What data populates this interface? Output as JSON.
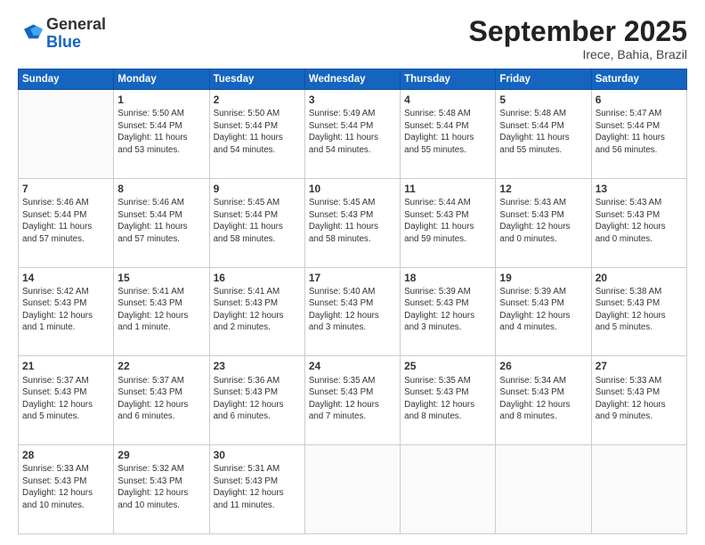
{
  "logo": {
    "general": "General",
    "blue": "Blue"
  },
  "header": {
    "month": "September 2025",
    "location": "Irece, Bahia, Brazil"
  },
  "weekdays": [
    "Sunday",
    "Monday",
    "Tuesday",
    "Wednesday",
    "Thursday",
    "Friday",
    "Saturday"
  ],
  "weeks": [
    [
      {
        "day": "",
        "text": ""
      },
      {
        "day": "1",
        "text": "Sunrise: 5:50 AM\nSunset: 5:44 PM\nDaylight: 11 hours\nand 53 minutes."
      },
      {
        "day": "2",
        "text": "Sunrise: 5:50 AM\nSunset: 5:44 PM\nDaylight: 11 hours\nand 54 minutes."
      },
      {
        "day": "3",
        "text": "Sunrise: 5:49 AM\nSunset: 5:44 PM\nDaylight: 11 hours\nand 54 minutes."
      },
      {
        "day": "4",
        "text": "Sunrise: 5:48 AM\nSunset: 5:44 PM\nDaylight: 11 hours\nand 55 minutes."
      },
      {
        "day": "5",
        "text": "Sunrise: 5:48 AM\nSunset: 5:44 PM\nDaylight: 11 hours\nand 55 minutes."
      },
      {
        "day": "6",
        "text": "Sunrise: 5:47 AM\nSunset: 5:44 PM\nDaylight: 11 hours\nand 56 minutes."
      }
    ],
    [
      {
        "day": "7",
        "text": "Sunrise: 5:46 AM\nSunset: 5:44 PM\nDaylight: 11 hours\nand 57 minutes."
      },
      {
        "day": "8",
        "text": "Sunrise: 5:46 AM\nSunset: 5:44 PM\nDaylight: 11 hours\nand 57 minutes."
      },
      {
        "day": "9",
        "text": "Sunrise: 5:45 AM\nSunset: 5:44 PM\nDaylight: 11 hours\nand 58 minutes."
      },
      {
        "day": "10",
        "text": "Sunrise: 5:45 AM\nSunset: 5:43 PM\nDaylight: 11 hours\nand 58 minutes."
      },
      {
        "day": "11",
        "text": "Sunrise: 5:44 AM\nSunset: 5:43 PM\nDaylight: 11 hours\nand 59 minutes."
      },
      {
        "day": "12",
        "text": "Sunrise: 5:43 AM\nSunset: 5:43 PM\nDaylight: 12 hours\nand 0 minutes."
      },
      {
        "day": "13",
        "text": "Sunrise: 5:43 AM\nSunset: 5:43 PM\nDaylight: 12 hours\nand 0 minutes."
      }
    ],
    [
      {
        "day": "14",
        "text": "Sunrise: 5:42 AM\nSunset: 5:43 PM\nDaylight: 12 hours\nand 1 minute."
      },
      {
        "day": "15",
        "text": "Sunrise: 5:41 AM\nSunset: 5:43 PM\nDaylight: 12 hours\nand 1 minute."
      },
      {
        "day": "16",
        "text": "Sunrise: 5:41 AM\nSunset: 5:43 PM\nDaylight: 12 hours\nand 2 minutes."
      },
      {
        "day": "17",
        "text": "Sunrise: 5:40 AM\nSunset: 5:43 PM\nDaylight: 12 hours\nand 3 minutes."
      },
      {
        "day": "18",
        "text": "Sunrise: 5:39 AM\nSunset: 5:43 PM\nDaylight: 12 hours\nand 3 minutes."
      },
      {
        "day": "19",
        "text": "Sunrise: 5:39 AM\nSunset: 5:43 PM\nDaylight: 12 hours\nand 4 minutes."
      },
      {
        "day": "20",
        "text": "Sunrise: 5:38 AM\nSunset: 5:43 PM\nDaylight: 12 hours\nand 5 minutes."
      }
    ],
    [
      {
        "day": "21",
        "text": "Sunrise: 5:37 AM\nSunset: 5:43 PM\nDaylight: 12 hours\nand 5 minutes."
      },
      {
        "day": "22",
        "text": "Sunrise: 5:37 AM\nSunset: 5:43 PM\nDaylight: 12 hours\nand 6 minutes."
      },
      {
        "day": "23",
        "text": "Sunrise: 5:36 AM\nSunset: 5:43 PM\nDaylight: 12 hours\nand 6 minutes."
      },
      {
        "day": "24",
        "text": "Sunrise: 5:35 AM\nSunset: 5:43 PM\nDaylight: 12 hours\nand 7 minutes."
      },
      {
        "day": "25",
        "text": "Sunrise: 5:35 AM\nSunset: 5:43 PM\nDaylight: 12 hours\nand 8 minutes."
      },
      {
        "day": "26",
        "text": "Sunrise: 5:34 AM\nSunset: 5:43 PM\nDaylight: 12 hours\nand 8 minutes."
      },
      {
        "day": "27",
        "text": "Sunrise: 5:33 AM\nSunset: 5:43 PM\nDaylight: 12 hours\nand 9 minutes."
      }
    ],
    [
      {
        "day": "28",
        "text": "Sunrise: 5:33 AM\nSunset: 5:43 PM\nDaylight: 12 hours\nand 10 minutes."
      },
      {
        "day": "29",
        "text": "Sunrise: 5:32 AM\nSunset: 5:43 PM\nDaylight: 12 hours\nand 10 minutes."
      },
      {
        "day": "30",
        "text": "Sunrise: 5:31 AM\nSunset: 5:43 PM\nDaylight: 12 hours\nand 11 minutes."
      },
      {
        "day": "",
        "text": ""
      },
      {
        "day": "",
        "text": ""
      },
      {
        "day": "",
        "text": ""
      },
      {
        "day": "",
        "text": ""
      }
    ]
  ]
}
